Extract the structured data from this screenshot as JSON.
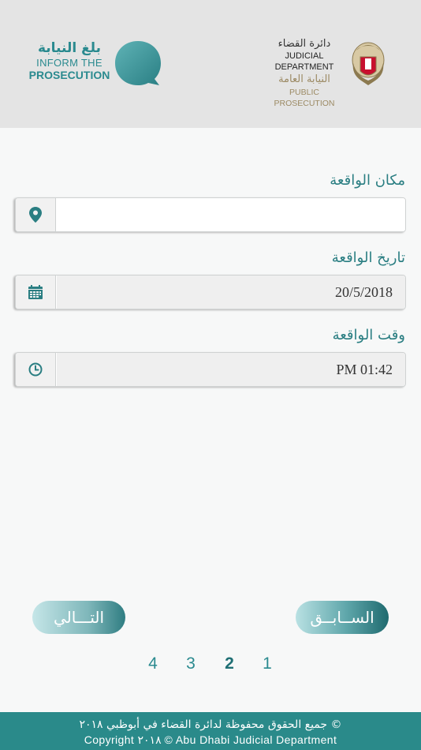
{
  "header": {
    "inform_logo": {
      "arabic": "بلغ النيابة",
      "line1": "INFORM THE",
      "line2": "PROSECUTION"
    },
    "jd_logo": {
      "arabic_top": "دائرة القضاء",
      "english_top": "JUDICIAL DEPARTMENT",
      "arabic_bottom": "النيابة العامة",
      "english_bottom": "PUBLIC PROSECUTION"
    }
  },
  "form": {
    "location": {
      "label": "مكان الواقعة",
      "value": "",
      "icon": "map-pin-icon"
    },
    "date": {
      "label": "تاريخ الواقعة",
      "value": "20/5/2018",
      "icon": "calendar-icon"
    },
    "time": {
      "label": "وقت الواقعة",
      "value": "PM 01:42",
      "icon": "clock-icon"
    }
  },
  "buttons": {
    "next_label": "التـــالي",
    "prev_label": "الســابــق"
  },
  "pagination": {
    "pages": [
      "4",
      "3",
      "2",
      "1"
    ],
    "current": "2"
  },
  "footer": {
    "arabic": "© جميع الحقوق محفوظة لدائرة القضاء في أبوظبي ٢٠١٨",
    "english": "Copyright ٢٠١٨ © Abu Dhabi Judicial Department"
  },
  "colors": {
    "accent": "#2a8a8f",
    "header_bg": "#e4e4e4",
    "footer_bg": "#2a8a8a",
    "gold": "#9c8a64"
  }
}
